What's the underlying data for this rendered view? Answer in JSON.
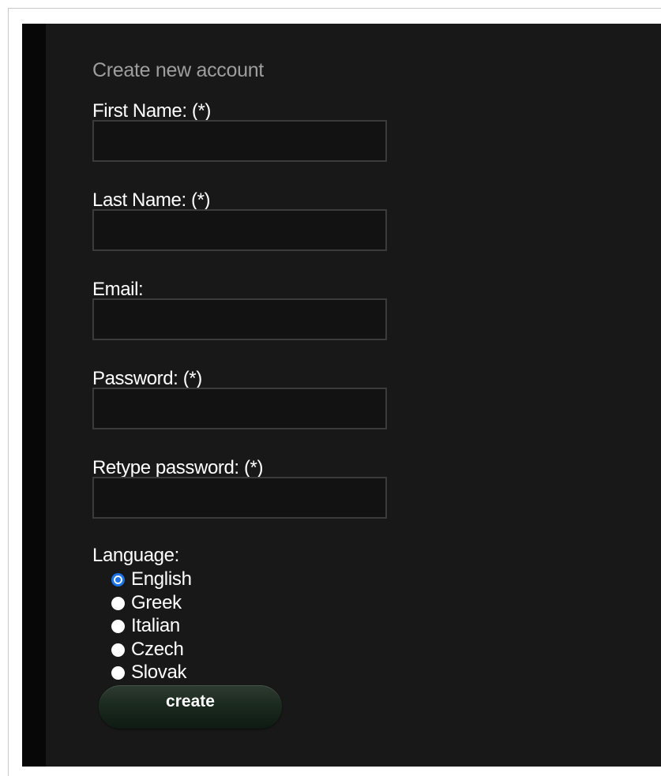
{
  "form": {
    "title": "Create new account",
    "fields": [
      {
        "label": "First Name: (*)",
        "value": ""
      },
      {
        "label": "Last Name: (*)",
        "value": ""
      },
      {
        "label": "Email:",
        "value": ""
      },
      {
        "label": "Password: (*)",
        "value": ""
      },
      {
        "label": "Retype password: (*)",
        "value": ""
      }
    ],
    "language": {
      "label": "Language:",
      "selected": "English",
      "options": [
        "English",
        "Greek",
        "Italian",
        "Czech",
        "Slovak"
      ]
    },
    "submit_label": "create"
  },
  "colors": {
    "page_background": "#181818",
    "input_background": "#121212",
    "input_border": "#3b3b3b",
    "heading_text": "#9e9e9e",
    "label_text": "#ffffff",
    "radio_accent": "#1a73e8",
    "button_background": "#1b2a1f"
  }
}
